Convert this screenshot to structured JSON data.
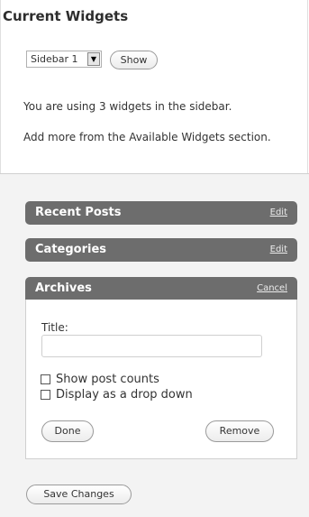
{
  "header": {
    "title": "Current Widgets"
  },
  "sidebar_select": {
    "selected": "Sidebar 1",
    "show_label": "Show"
  },
  "info": {
    "count_text": "You are using 3 widgets in the sidebar.",
    "add_more_text": "Add more from the Available Widgets section."
  },
  "widgets": [
    {
      "name": "Recent Posts",
      "link": "Edit"
    },
    {
      "name": "Categories",
      "link": "Edit"
    },
    {
      "name": "Archives",
      "link": "Cancel"
    }
  ],
  "archives_form": {
    "title_label": "Title:",
    "title_value": "",
    "show_post_counts_label": "Show post counts",
    "show_post_counts_checked": false,
    "dropdown_label": "Display as a drop down",
    "dropdown_checked": false,
    "done_label": "Done",
    "remove_label": "Remove"
  },
  "footer": {
    "save_label": "Save Changes"
  },
  "colors": {
    "widget_header": "#6d6d6d",
    "panel_bg": "#f3f3f3"
  }
}
